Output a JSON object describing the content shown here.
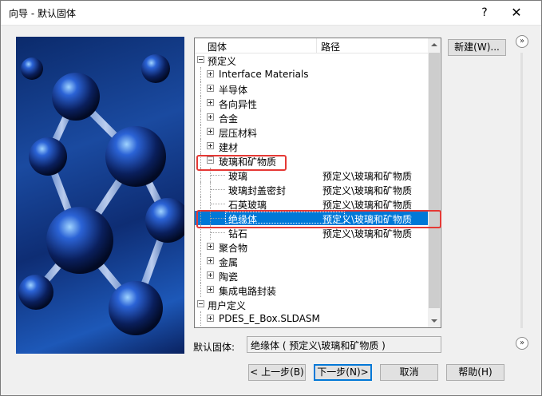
{
  "window": {
    "title": "向导 - 默认固体",
    "help_glyph": "?",
    "close_glyph": "✕"
  },
  "tree": {
    "headers": {
      "name": "固体",
      "path": "路径"
    },
    "rows": [
      {
        "label": "预定义",
        "path": "",
        "state": "expanded"
      },
      {
        "label": "Interface Materials",
        "path": "",
        "state": "collapsed"
      },
      {
        "label": "半导体",
        "path": "",
        "state": "collapsed"
      },
      {
        "label": "各向异性",
        "path": "",
        "state": "collapsed"
      },
      {
        "label": "合金",
        "path": "",
        "state": "collapsed"
      },
      {
        "label": "层压材料",
        "path": "",
        "state": "collapsed"
      },
      {
        "label": "建材",
        "path": "",
        "state": "collapsed"
      },
      {
        "label": "玻璃和矿物质",
        "path": "",
        "state": "expanded"
      },
      {
        "label": "玻璃",
        "path": "预定义\\玻璃和矿物质",
        "state": "leaf"
      },
      {
        "label": "玻璃封盖密封",
        "path": "预定义\\玻璃和矿物质",
        "state": "leaf"
      },
      {
        "label": "石英玻璃",
        "path": "预定义\\玻璃和矿物质",
        "state": "leaf"
      },
      {
        "label": "绝缘体",
        "path": "预定义\\玻璃和矿物质",
        "state": "leaf",
        "selected": true
      },
      {
        "label": "钻石",
        "path": "预定义\\玻璃和矿物质",
        "state": "leaf"
      },
      {
        "label": "聚合物",
        "path": "",
        "state": "collapsed"
      },
      {
        "label": "金属",
        "path": "",
        "state": "collapsed"
      },
      {
        "label": "陶瓷",
        "path": "",
        "state": "collapsed"
      },
      {
        "label": "集成电路封装",
        "path": "",
        "state": "collapsed"
      },
      {
        "label": "用户定义",
        "path": "",
        "state": "expanded"
      },
      {
        "label": "PDES_E_Box.SLDASM",
        "path": "",
        "state": "collapsed"
      }
    ]
  },
  "new_button": "新建(W)...",
  "expand_glyph": "»",
  "default_solid": {
    "label": "默认固体:",
    "value": "绝缘体 ( 预定义\\玻璃和矿物质 )"
  },
  "buttons": {
    "back": "< 上一步(B)",
    "next": "下一步(N)>",
    "cancel": "取消",
    "help": "帮助(H)"
  },
  "colors": {
    "selection": "#0078d7",
    "highlight_box": "#e53935"
  }
}
